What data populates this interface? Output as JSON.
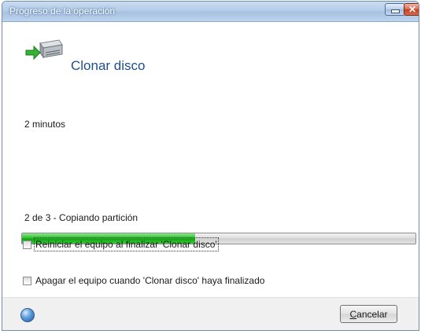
{
  "window": {
    "title": "Progreso de la operación",
    "minimize_icon": "minimize-icon",
    "close_icon": "close-icon",
    "close_glyph": "✕"
  },
  "header": {
    "icon": "clone-disk-icon",
    "title": "Clonar disco"
  },
  "status": {
    "time_remaining": "2 minutos",
    "step_text": "2 de 3 - Copiando partición",
    "progress_fraction": 0.44
  },
  "options": [
    {
      "label": "Reiniciar el equipo al finalizar 'Clonar disco'",
      "checked": false
    },
    {
      "label": "Apagar el equipo cuando 'Clonar disco' haya finalizado",
      "checked": false
    }
  ],
  "footer": {
    "help_icon": "help-icon",
    "cancel_label_underlined": "C",
    "cancel_label_rest": "ancelar"
  },
  "colors": {
    "title_text": "#1f4e8c",
    "progress_fill": "#1aa81a"
  }
}
